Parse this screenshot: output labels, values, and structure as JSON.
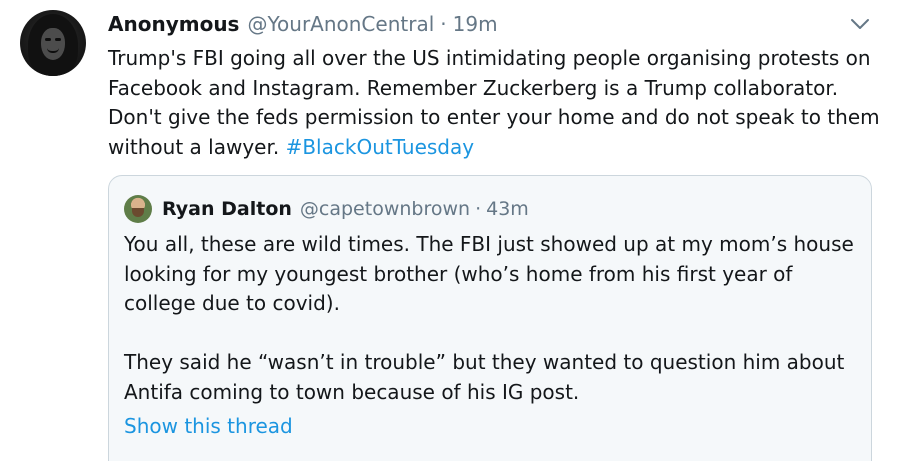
{
  "tweet": {
    "author_name": "Anonymous",
    "author_handle": "@YourAnonCentral",
    "separator": "·",
    "time": "19m",
    "text": "Trump's FBI going all over the US intimidating people organising protests on Facebook and Instagram. Remember Zuckerberg is a Trump collaborator. Don't give the feds permission to enter your home and do not speak to them without a lawyer. ",
    "hashtag": "#BlackOutTuesday",
    "menu_icon": "chevron-down-icon"
  },
  "quoted_tweet": {
    "author_name": "Ryan Dalton",
    "author_handle": "@capetownbrown",
    "separator": "·",
    "time": "43m",
    "text": "You all, these are wild times. The FBI just showed up at my mom’s house looking for my youngest brother (who’s home from his first year of college due to covid).\n\nThey said he “wasn’t in trouble” but they wanted to question him about Antifa coming to town because of his IG post.",
    "show_thread_label": "Show this thread"
  },
  "colors": {
    "text": "#14171a",
    "secondary": "#657786",
    "link": "#1b95e0",
    "quote_border": "#ccd6dd",
    "quote_bg": "#f5f8fa"
  }
}
